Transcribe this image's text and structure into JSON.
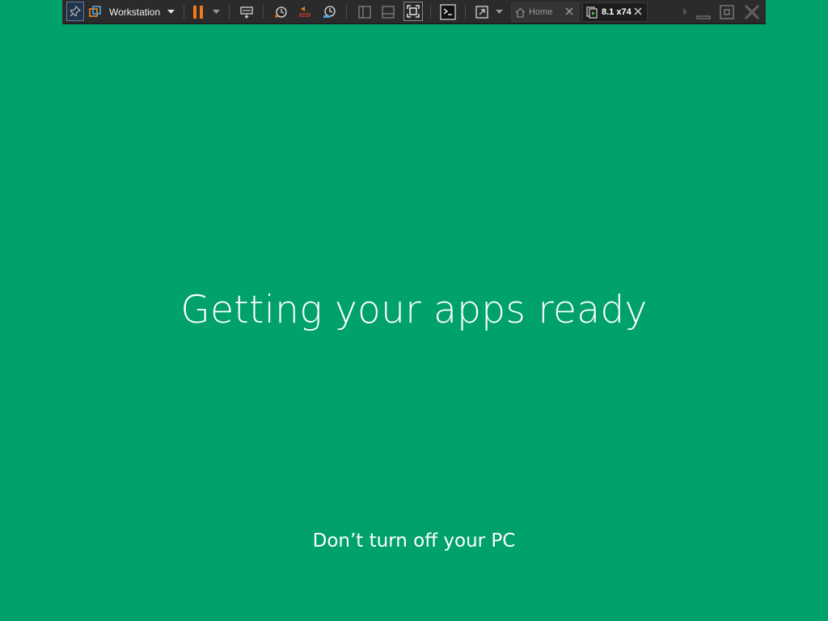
{
  "toolbar": {
    "product_label": "Workstation",
    "tabs": [
      {
        "label": "Home",
        "icon": "home-icon",
        "active": false
      },
      {
        "label": "8.1 x74",
        "icon": "vm-icon",
        "active": true
      }
    ],
    "icons": [
      "pin-icon",
      "vmware-logo-icon",
      "dropdown-arrow-icon",
      "pause-icon",
      "send-keys-icon",
      "snapshot-icon",
      "revert-snapshot-icon",
      "snapshot-manager-icon",
      "library-icon",
      "thumbnail-bar-icon",
      "fullscreen-icon",
      "console-icon",
      "stretch-icon",
      "scroll-right-icon",
      "minimize-icon",
      "restore-icon",
      "close-icon"
    ],
    "colors": {
      "bar": "#2b2b2b",
      "pause": "#f07a1c",
      "accent": "#4fa3e0"
    }
  },
  "setup": {
    "headline": "Getting your apps ready",
    "subline": "Don’t turn off your PC",
    "background": "#00a16a"
  }
}
